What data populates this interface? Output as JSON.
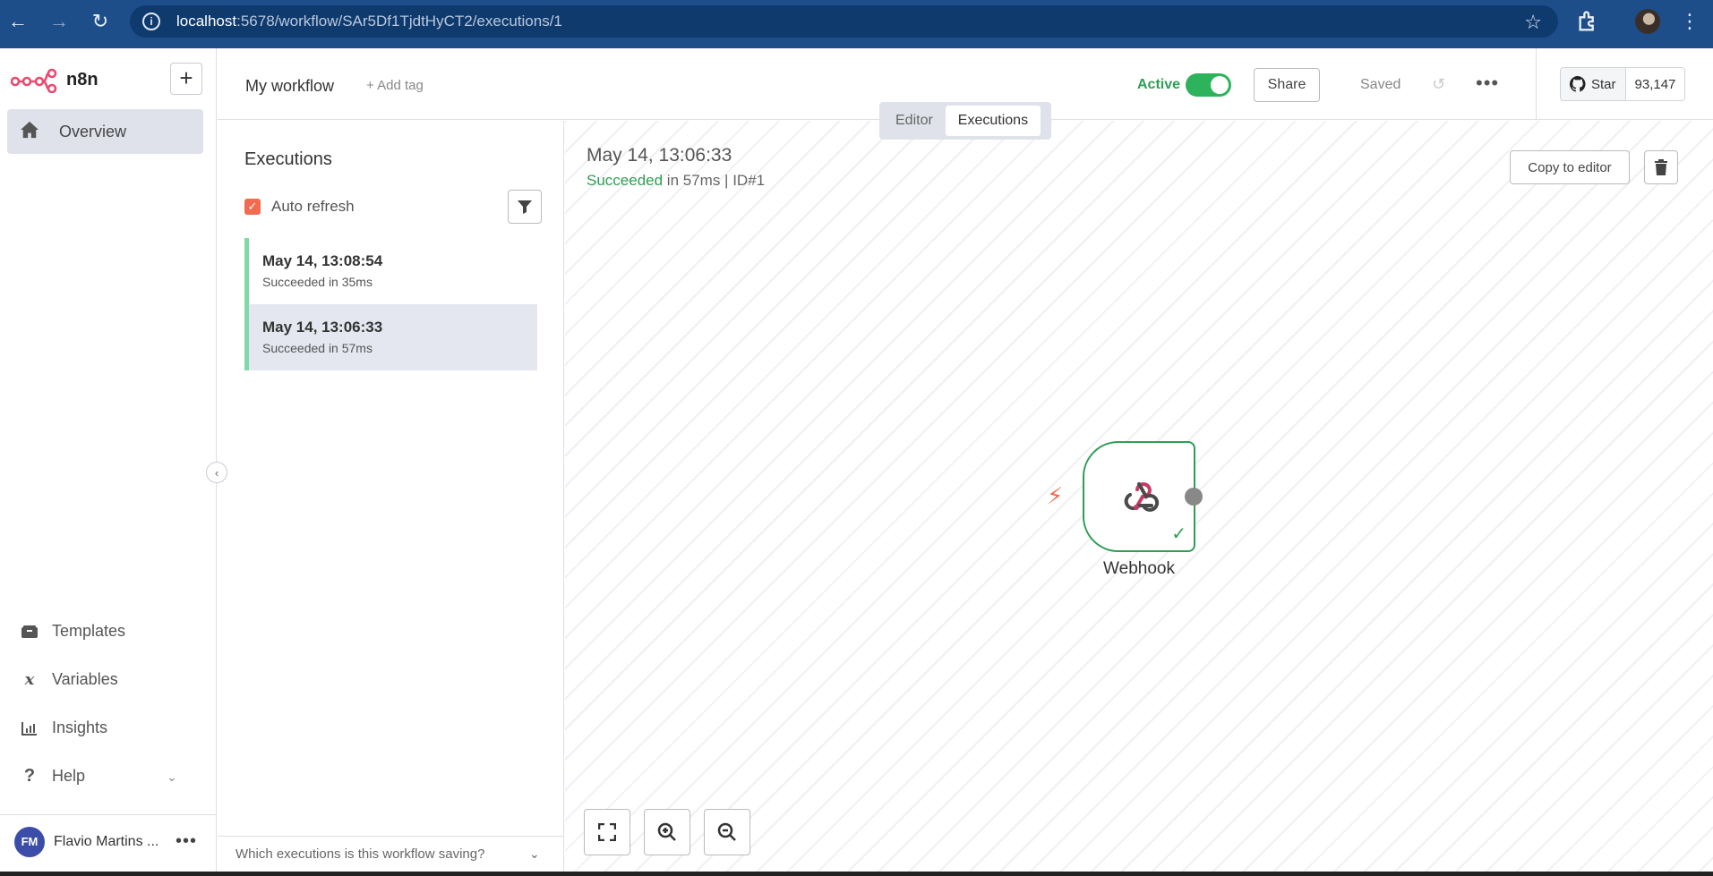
{
  "browser": {
    "url_host": "localhost",
    "url_path": ":5678/workflow/SAr5Df1TjdtHyCT2/executions/1"
  },
  "sidebar": {
    "brand": "n8n",
    "add_label": "+",
    "overview": "Overview",
    "items": [
      {
        "label": "Templates",
        "icon": "box-icon"
      },
      {
        "label": "Variables",
        "icon": "variable-icon"
      },
      {
        "label": "Insights",
        "icon": "chart-icon"
      },
      {
        "label": "Help",
        "icon": "question-icon"
      }
    ],
    "user_initials": "FM",
    "user_name": "Flavio Martins ..."
  },
  "header": {
    "workflow_name": "My workflow",
    "add_tag": "+ Add tag",
    "active_label": "Active",
    "active": true,
    "share": "Share",
    "saved": "Saved",
    "github_star": "Star",
    "github_count": "93,147"
  },
  "tabs": {
    "editor": "Editor",
    "executions": "Executions",
    "selected": "Executions"
  },
  "executions": {
    "title": "Executions",
    "auto_refresh": "Auto refresh",
    "auto_refresh_checked": true,
    "items": [
      {
        "time": "May 14, 13:08:54",
        "status": "Succeeded in 35ms",
        "selected": false
      },
      {
        "time": "May 14, 13:06:33",
        "status": "Succeeded in 57ms",
        "selected": true
      }
    ],
    "footer_question": "Which executions is this workflow saving?"
  },
  "canvas": {
    "time": "May 14, 13:06:33",
    "status_word": "Succeeded",
    "status_rest": " in 57ms | ID#1",
    "copy_to_editor": "Copy to editor",
    "node_label": "Webhook"
  },
  "colors": {
    "accent": "#f06b50",
    "success": "#2e9e55",
    "browser": "#1d4e89"
  }
}
